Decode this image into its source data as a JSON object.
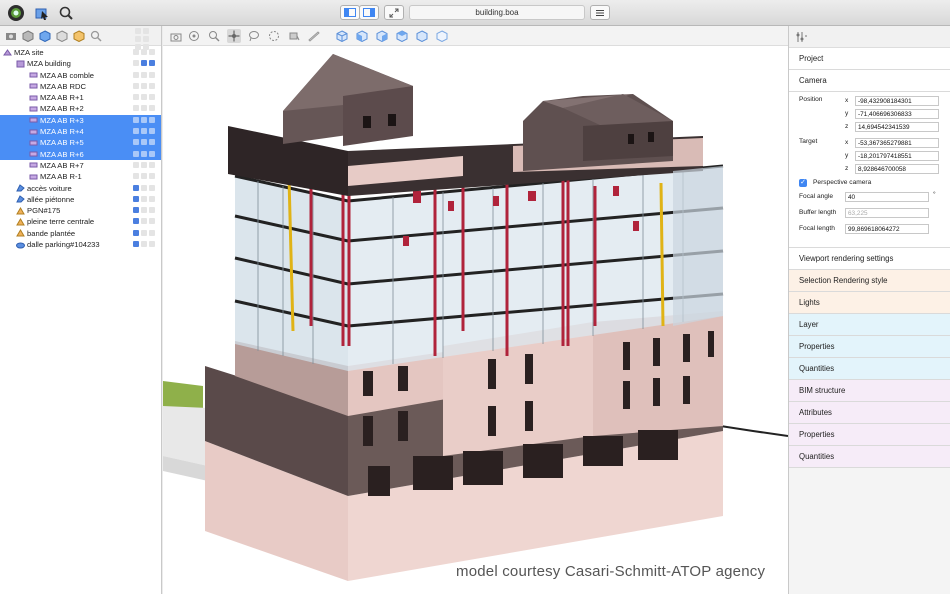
{
  "window": {
    "document_title": "building.boa"
  },
  "colors": {
    "selection": "#4a8ef5",
    "accent_blue": "#3f86f2",
    "facade_pink": "#e6c8c3",
    "dark_facade": "#4a3f3f",
    "pipe_red": "#b0233b"
  },
  "toolbar_icons": [
    "app-icon",
    "select-tool-icon",
    "search-icon",
    "layout-left-icon",
    "layout-right-icon",
    "fullscreen-icon",
    "menu-icon"
  ],
  "tree": {
    "rows": [
      {
        "label": "MZA site",
        "indent": 0,
        "icon": "site-icon",
        "selected": false
      },
      {
        "label": "MZA building",
        "indent": 1,
        "icon": "building-icon",
        "selected": false
      },
      {
        "label": "MZA AB comble",
        "indent": 2,
        "icon": "storey-icon",
        "selected": false
      },
      {
        "label": "MZA AB RDC",
        "indent": 2,
        "icon": "storey-icon",
        "selected": false
      },
      {
        "label": "MZA AB R+1",
        "indent": 2,
        "icon": "storey-icon",
        "selected": false
      },
      {
        "label": "MZA AB R+2",
        "indent": 2,
        "icon": "storey-icon",
        "selected": false
      },
      {
        "label": "MZA AB R+3",
        "indent": 2,
        "icon": "storey-icon",
        "selected": true
      },
      {
        "label": "MZA AB R+4",
        "indent": 2,
        "icon": "storey-icon",
        "selected": true
      },
      {
        "label": "MZA AB R+5",
        "indent": 2,
        "icon": "storey-icon",
        "selected": true
      },
      {
        "label": "MZA AB R+6",
        "indent": 2,
        "icon": "storey-icon",
        "selected": true
      },
      {
        "label": "MZA AB R+7",
        "indent": 2,
        "icon": "storey-icon",
        "selected": false
      },
      {
        "label": "MZA AB R-1",
        "indent": 2,
        "icon": "storey-icon",
        "selected": false
      },
      {
        "label": "accès voiture",
        "indent": 1,
        "icon": "object-icon",
        "selected": false
      },
      {
        "label": "allée piétonne",
        "indent": 1,
        "icon": "object-icon",
        "selected": false
      },
      {
        "label": "PGN#175",
        "indent": 1,
        "icon": "proxy-icon",
        "selected": false
      },
      {
        "label": "pleine terre centrale",
        "indent": 1,
        "icon": "proxy-icon",
        "selected": false
      },
      {
        "label": "bande plantée",
        "indent": 1,
        "icon": "proxy-icon",
        "selected": false
      },
      {
        "label": "dalle parking#104233",
        "indent": 1,
        "icon": "slab-icon",
        "selected": false
      }
    ]
  },
  "viewport": {
    "credit": "model courtesy Casari-Schmitt-ATOP agency"
  },
  "inspector": {
    "sections_top": [
      "Project",
      "Camera"
    ],
    "camera": {
      "position_label": "Position",
      "target_label": "Target",
      "axes": [
        "x",
        "y",
        "z"
      ],
      "position": [
        "-98,432908184301",
        "-71,406696306833",
        "14,694542341539"
      ],
      "target": [
        "-53,367365279881",
        "-18,201797418551",
        "8,928646700058"
      ],
      "perspective_label": "Perspective camera",
      "perspective_checked": true,
      "focal_angle_label": "Focal angle",
      "focal_angle": "40",
      "focal_angle_unit": "°",
      "buffer_length_label": "Buffer length",
      "buffer_length": "63,225",
      "focal_length_label": "Focal length",
      "focal_length": "99,869618064272"
    },
    "sections": [
      {
        "label": "Viewport rendering settings",
        "tone": "white"
      },
      {
        "label": "Selection Rendering style",
        "tone": "orange"
      },
      {
        "label": "Lights",
        "tone": "orange"
      },
      {
        "label": "Layer",
        "tone": "cyan"
      },
      {
        "label": "Properties",
        "tone": "cyan"
      },
      {
        "label": "Quantities",
        "tone": "cyan"
      },
      {
        "label": "BIM structure",
        "tone": "purple"
      },
      {
        "label": "Attributes",
        "tone": "purple"
      },
      {
        "label": "Properties",
        "tone": "purple"
      },
      {
        "label": "Quantities",
        "tone": "purple"
      }
    ]
  }
}
